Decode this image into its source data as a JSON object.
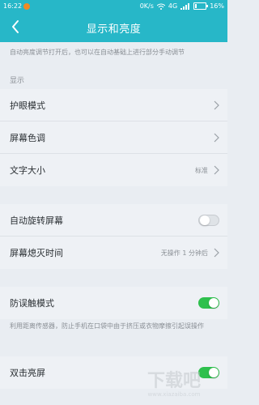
{
  "status_bar": {
    "time": "16:22",
    "network_speed": "0K/s",
    "network_type": "4G",
    "battery": "16%",
    "battery_level": 0.16
  },
  "header": {
    "title": "显示和亮度"
  },
  "description_top": "自动亮度调节打开后，也可以在自动基础上进行部分手动调节",
  "section_display": "显示",
  "group1": [
    {
      "label": "护眼模式",
      "value": ""
    },
    {
      "label": "屏幕色调",
      "value": ""
    },
    {
      "label": "文字大小",
      "value": "标准"
    }
  ],
  "group2": [
    {
      "label": "自动旋转屏幕",
      "toggle": false
    },
    {
      "label": "屏幕熄灭时间",
      "value": "无操作 1 分钟后"
    }
  ],
  "group3": [
    {
      "label": "防误触模式",
      "toggle": true
    }
  ],
  "description_bottom": "利用距离传感器，防止手机在口袋中由于挤压或衣物摩擦引起误操作",
  "group4": [
    {
      "label": "双击亮屏",
      "toggle": true
    }
  ],
  "colors": {
    "accent": "#27b7c8",
    "toggle_on": "#2ec04d",
    "background": "#eef1f5"
  },
  "watermark": "下载吧 www.xiazaiba.com"
}
